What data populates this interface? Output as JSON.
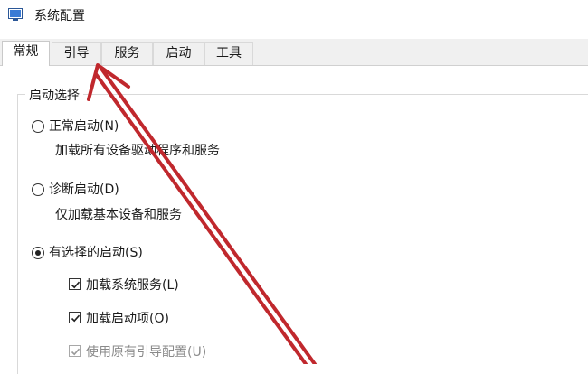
{
  "window": {
    "title": "系统配置"
  },
  "tabs": [
    {
      "label": "常规",
      "active": true
    },
    {
      "label": "引导",
      "active": false
    },
    {
      "label": "服务",
      "active": false
    },
    {
      "label": "启动",
      "active": false
    },
    {
      "label": "工具",
      "active": false
    }
  ],
  "startup_selection": {
    "legend": "启动选择",
    "normal": {
      "label": "正常启动(N)",
      "desc": "加载所有设备驱动程序和服务",
      "selected": false
    },
    "diagnostic": {
      "label": "诊断启动(D)",
      "desc": "仅加载基本设备和服务",
      "selected": false
    },
    "selective": {
      "label": "有选择的启动(S)",
      "selected": true
    },
    "options": [
      {
        "label": "加载系统服务(L)",
        "checked": true,
        "enabled": true
      },
      {
        "label": "加载启动项(O)",
        "checked": true,
        "enabled": true
      },
      {
        "label": "使用原有引导配置(U)",
        "checked": true,
        "enabled": false
      }
    ]
  },
  "annotation": {
    "arrow_color": "#c0282d"
  }
}
